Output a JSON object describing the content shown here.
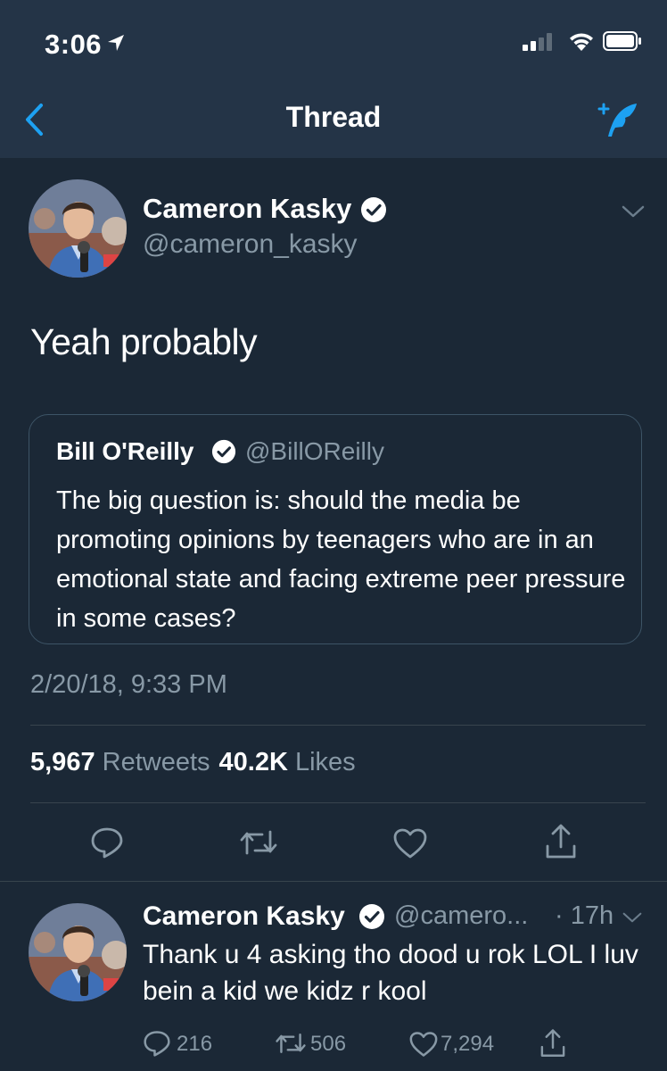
{
  "status_bar": {
    "time": "3:06"
  },
  "nav": {
    "title": "Thread"
  },
  "main_tweet": {
    "author_name": "Cameron Kasky",
    "handle": "@cameron_kasky",
    "text": "Yeah probably",
    "quote": {
      "author_name": "Bill O'Reilly",
      "handle": "@BillOReilly",
      "text": "The big question is: should the media be promoting opinions by teenagers who are in an emotional state and facing extreme peer pressure in some cases?"
    },
    "timestamp": "2/20/18, 9:33 PM",
    "retweets_count": "5,967",
    "retweets_label": "Retweets",
    "likes_count": "40.2K",
    "likes_label": "Likes"
  },
  "reply_tweet": {
    "author_name": "Cameron Kasky",
    "handle": "@camero...",
    "time": "· 17h",
    "text": "Thank u 4 asking tho dood u rok LOL I luv bein a kid we kidz r kool",
    "replies": "216",
    "retweets": "506",
    "likes": "7,294"
  },
  "colors": {
    "background": "#1b2836",
    "header": "#243447",
    "accent": "#1da1f2",
    "secondary_text": "#8899a6",
    "divider": "#38444d"
  },
  "icons": [
    "location-arrow-icon",
    "signal-icon",
    "wifi-icon",
    "battery-icon",
    "back-chevron-icon",
    "compose-feather-icon",
    "verified-icon",
    "chevron-down-icon",
    "reply-icon",
    "retweet-icon",
    "like-icon",
    "share-icon"
  ]
}
